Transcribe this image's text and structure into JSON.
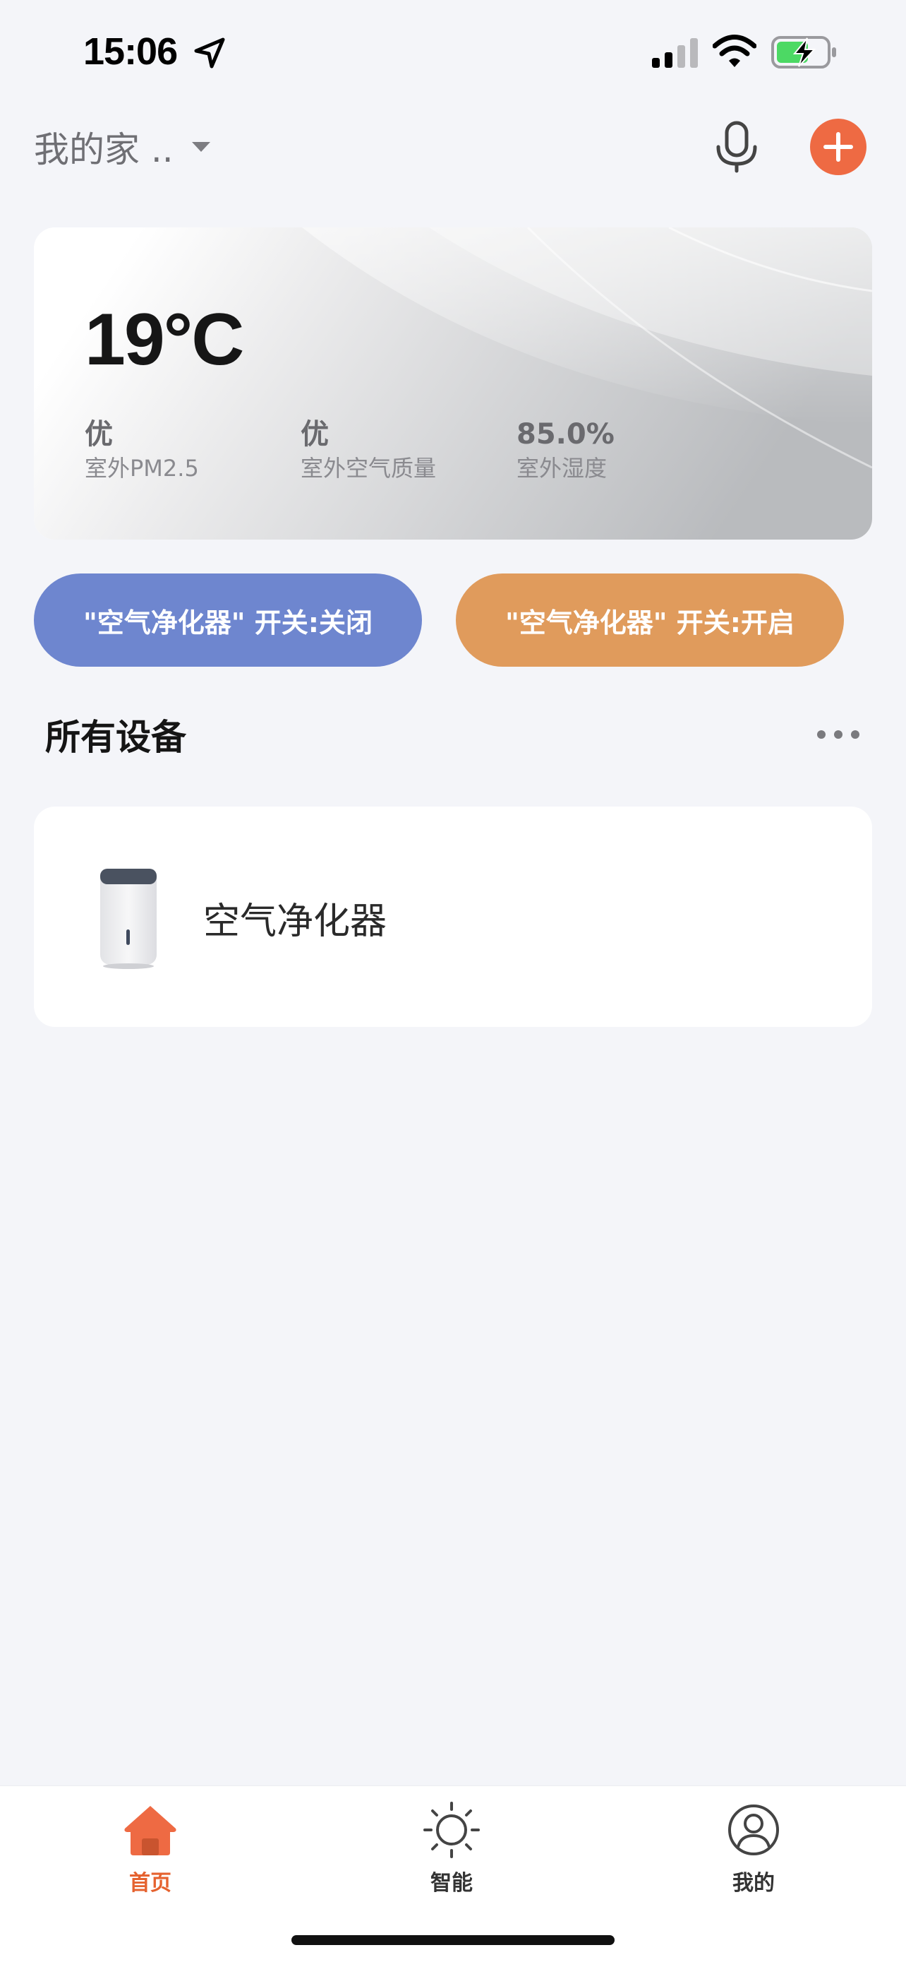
{
  "status_bar": {
    "time": "15:06",
    "icons": [
      "location-arrow-icon",
      "cellular-signal-icon",
      "wifi-icon",
      "battery-charging-icon"
    ]
  },
  "header": {
    "home_name": "我的家 ..",
    "mic_icon": "microphone-icon",
    "add_icon": "plus-icon",
    "accent_color": "#ee6a43"
  },
  "weather": {
    "temperature": "19°C",
    "metrics": [
      {
        "value": "优",
        "label": "室外PM2.5"
      },
      {
        "value": "优",
        "label": "室外空气质量"
      },
      {
        "value": "85.0%",
        "label": "室外湿度"
      }
    ]
  },
  "scenes": [
    {
      "label": "\"空气净化器\" 开关:关闭",
      "color": "#6e86cf"
    },
    {
      "label": "\"空气净化器\" 开关:开启",
      "color": "#e09b5c"
    }
  ],
  "devices_section": {
    "title": "所有设备",
    "more_icon": "more-dots-icon"
  },
  "devices": [
    {
      "name": "空气净化器",
      "icon": "air-purifier-image"
    }
  ],
  "tab_bar": {
    "tabs": [
      {
        "label": "首页",
        "icon": "home-icon",
        "active": true
      },
      {
        "label": "智能",
        "icon": "sun-icon",
        "active": false
      },
      {
        "label": "我的",
        "icon": "user-icon",
        "active": false
      }
    ],
    "active_color": "#e5622f"
  }
}
